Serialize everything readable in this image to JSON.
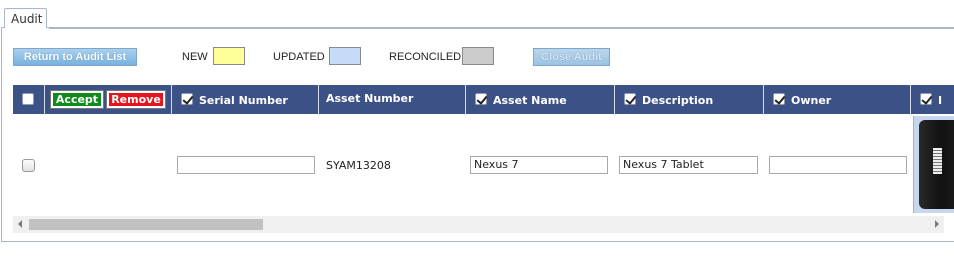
{
  "tab": {
    "label": "Audit"
  },
  "toolbar": {
    "return_label": "Return to Audit List",
    "close_label": "Close Audit"
  },
  "legend": {
    "new_label": "NEW",
    "new_color": "#ffff99",
    "updated_label": "UPDATED",
    "updated_color": "#c6dbf7",
    "reconciled_label": "RECONCILED",
    "reconciled_color": "#cccccc"
  },
  "grid": {
    "header_color": "#3c5186",
    "accept_label": "Accept",
    "remove_label": "Remove",
    "columns": [
      {
        "label": "Serial Number",
        "checked": true
      },
      {
        "label": "Asset Number",
        "checked": false
      },
      {
        "label": "Asset Name",
        "checked": true
      },
      {
        "label": "Description",
        "checked": true
      },
      {
        "label": "Owner",
        "checked": true
      },
      {
        "label": "I",
        "checked": true
      }
    ],
    "rows": [
      {
        "serial_number": "",
        "asset_number": "SYAM13208",
        "asset_name": "Nexus 7",
        "description": "Nexus 7 Tablet",
        "owner": ""
      }
    ]
  }
}
